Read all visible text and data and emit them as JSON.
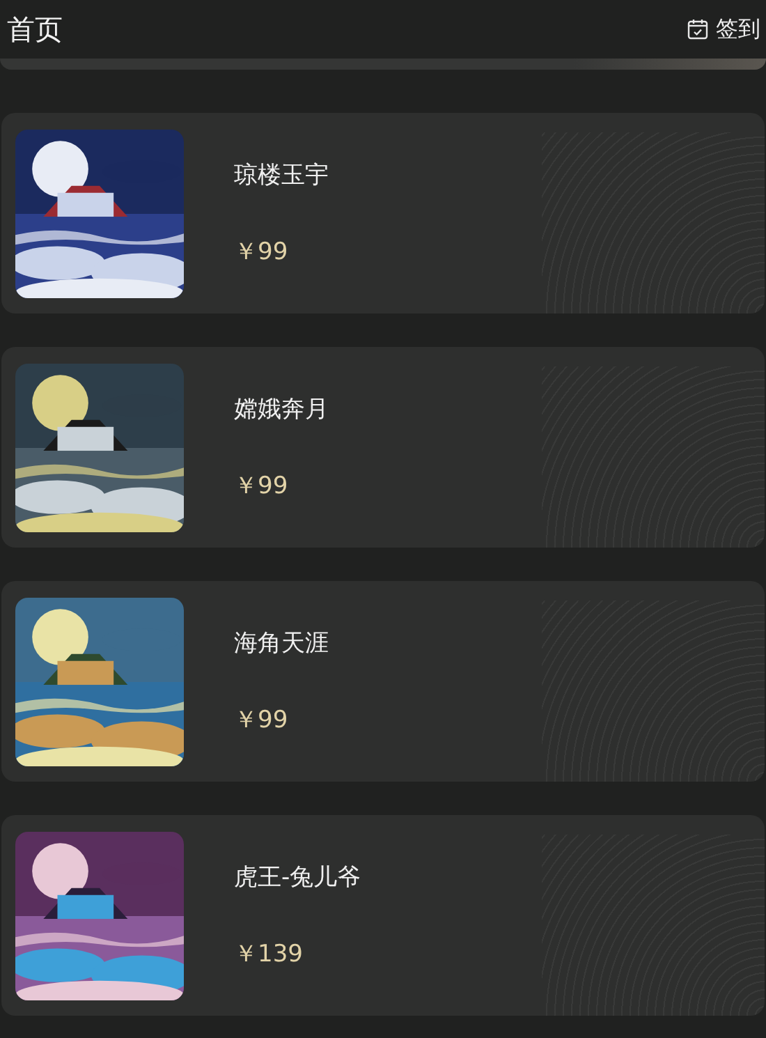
{
  "header": {
    "title": "首页",
    "checkin_label": "签到"
  },
  "products": [
    {
      "name": "琼楼玉宇",
      "price": "￥99"
    },
    {
      "name": "嫦娥奔月",
      "price": "￥99"
    },
    {
      "name": "海角天涯",
      "price": "￥99"
    },
    {
      "name": "虎王-兔儿爷",
      "price": "￥139"
    }
  ]
}
